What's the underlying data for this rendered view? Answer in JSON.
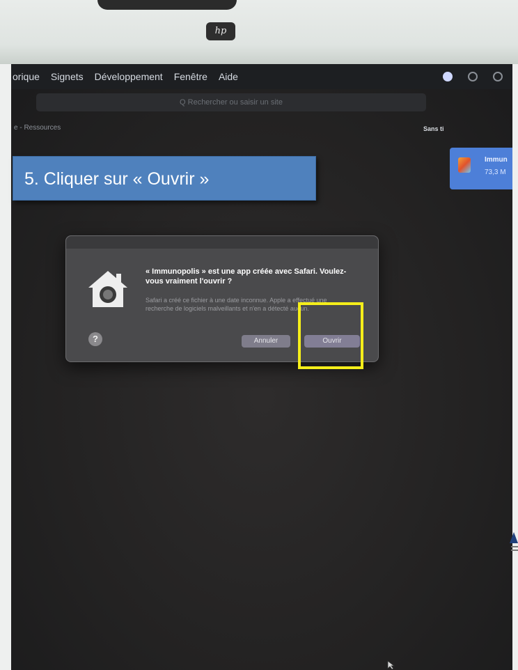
{
  "menubar": {
    "items": [
      "orique",
      "Signets",
      "Développement",
      "Fenêtre",
      "Aide"
    ]
  },
  "search": {
    "placeholder": "Q  Rechercher ou saisir un site"
  },
  "breadcrumb": "e - Ressources",
  "sidebar_label": "Sans ti",
  "download": {
    "name": "Immun",
    "size": "73,3 M"
  },
  "callout": {
    "text": "5. Cliquer sur « Ouvrir »"
  },
  "dialog": {
    "title": "« Immunopolis » est une app créée avec Safari. Voulez-vous vraiment l'ouvrir ?",
    "body": "Safari a créé ce fichier à une date inconnue. Apple a effectué une recherche de logiciels malveillants et n'en a détecté aucun.",
    "cancel_label": "Annuler",
    "open_label": "Ouvrir",
    "help_label": "?"
  },
  "brand": {
    "logo": "hp"
  },
  "colors": {
    "callout": "#4f81bd",
    "highlight": "#f5ee1a",
    "dialog": "#4a4a4c"
  }
}
